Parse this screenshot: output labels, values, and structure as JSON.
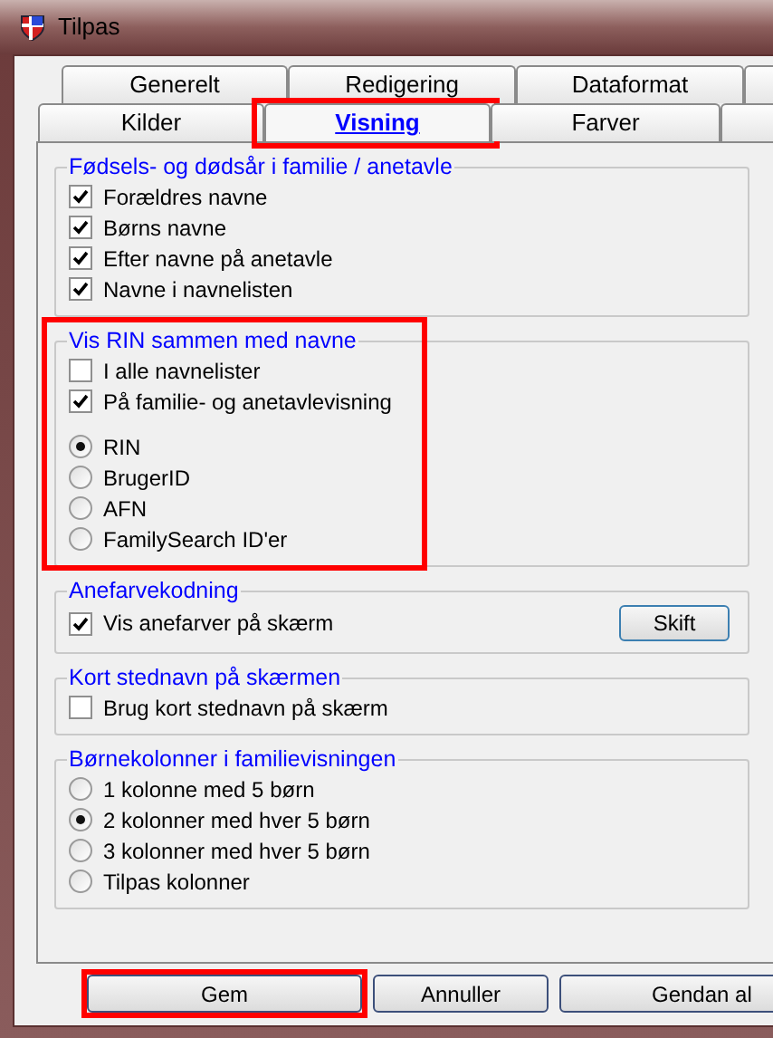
{
  "window": {
    "title": "Tilpas"
  },
  "tab_rows": [
    {
      "tabs": [
        {
          "label": "Generelt",
          "selected": false,
          "highlighted": false
        },
        {
          "label": "Redigering",
          "selected": false,
          "highlighted": false
        },
        {
          "label": "Dataformat",
          "selected": false,
          "highlighted": false
        }
      ]
    },
    {
      "tabs": [
        {
          "label": "Kilder",
          "selected": false,
          "highlighted": false
        },
        {
          "label": "Visning",
          "selected": true,
          "highlighted": true
        },
        {
          "label": "Farver",
          "selected": false,
          "highlighted": false
        }
      ]
    }
  ],
  "groups": [
    {
      "title": "Fødsels- og dødsår i familie / anetavle",
      "highlighted": false,
      "items": [
        {
          "kind": "checkbox",
          "label": "Forældres navne",
          "checked": true
        },
        {
          "kind": "checkbox",
          "label": "Børns navne",
          "checked": true
        },
        {
          "kind": "checkbox",
          "label": "Efter navne på anetavle",
          "checked": true
        },
        {
          "kind": "checkbox",
          "label": "Navne i navnelisten",
          "checked": true
        }
      ]
    },
    {
      "title": "Vis RIN sammen med navne",
      "highlighted": true,
      "items": [
        {
          "kind": "checkbox",
          "label": "I alle navnelister",
          "checked": false
        },
        {
          "kind": "checkbox",
          "label": "På familie- og anetavlevisning",
          "checked": true
        },
        {
          "kind": "radio",
          "label": "RIN",
          "selected": true
        },
        {
          "kind": "radio",
          "label": "BrugerID",
          "selected": false
        },
        {
          "kind": "radio",
          "label": "AFN",
          "selected": false
        },
        {
          "kind": "radio",
          "label": "FamilySearch ID'er",
          "selected": false
        }
      ]
    },
    {
      "title": "Anefarvekodning",
      "highlighted": false,
      "button": "Skift",
      "items": [
        {
          "kind": "checkbox",
          "label": "Vis anefarver på skærm",
          "checked": true
        }
      ]
    },
    {
      "title": "Kort stednavn på skærmen",
      "highlighted": false,
      "items": [
        {
          "kind": "checkbox",
          "label": "Brug kort stednavn på skærm",
          "checked": false
        }
      ]
    },
    {
      "title": "Børnekolonner i familievisningen",
      "highlighted": false,
      "items": [
        {
          "kind": "radio",
          "label": "1 kolonne med 5 børn",
          "selected": false
        },
        {
          "kind": "radio",
          "label": "2 kolonner med hver 5 børn",
          "selected": true
        },
        {
          "kind": "radio",
          "label": "3 kolonner med hver 5 børn",
          "selected": false
        },
        {
          "kind": "radio",
          "label": "Tilpas kolonner",
          "selected": false
        }
      ]
    }
  ],
  "buttons": [
    {
      "label": "Gem",
      "highlighted": true
    },
    {
      "label": "Annuller",
      "highlighted": false
    },
    {
      "label": "Gendan al",
      "highlighted": false
    }
  ]
}
